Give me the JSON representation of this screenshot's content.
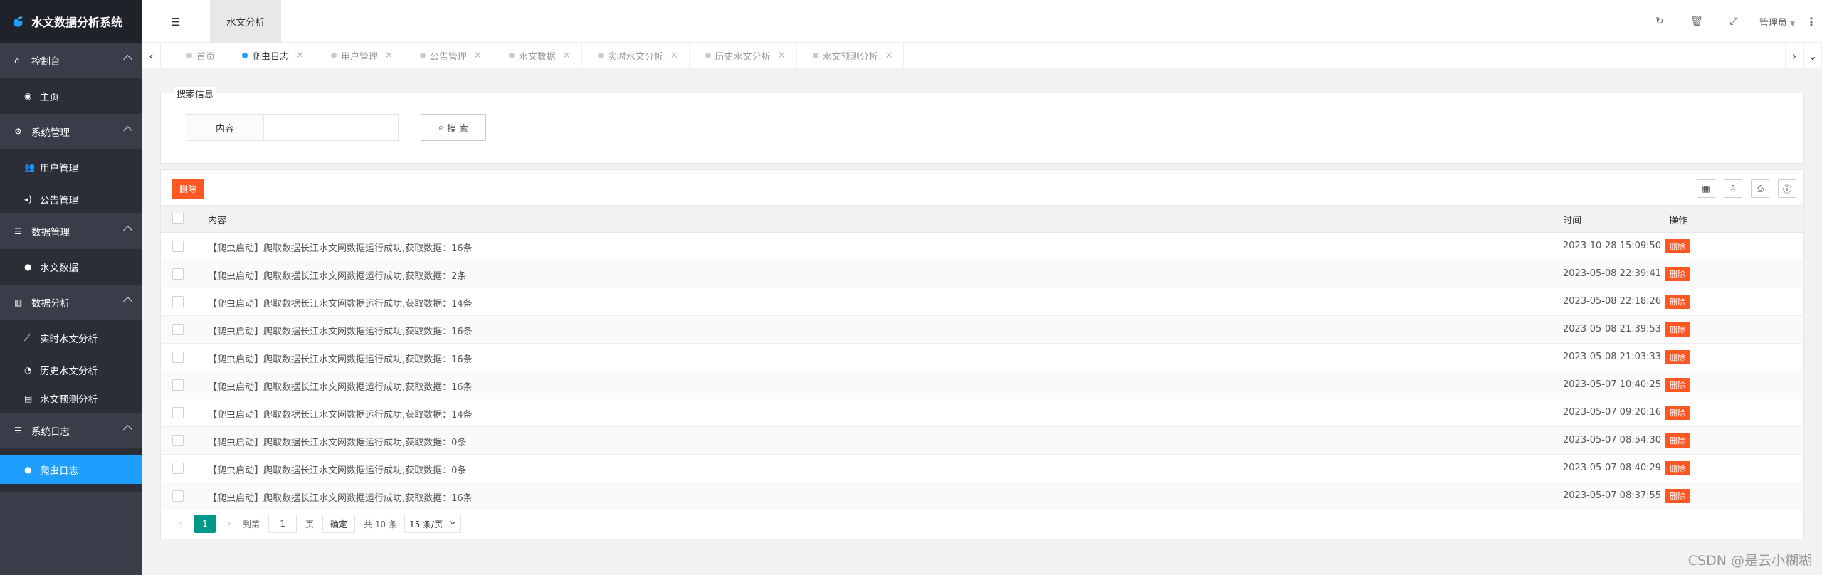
{
  "app": {
    "title": "水文数据分析系统"
  },
  "sidebar": {
    "groups": [
      {
        "label": "控制台",
        "icon": "home-icon",
        "items": [
          {
            "label": "主页",
            "icon": "dashboard-icon"
          }
        ]
      },
      {
        "label": "系统管理",
        "icon": "gears-icon",
        "items": [
          {
            "label": "用户管理",
            "icon": "users-icon"
          },
          {
            "label": "公告管理",
            "icon": "volume-icon"
          }
        ]
      },
      {
        "label": "数据管理",
        "icon": "list-icon",
        "items": [
          {
            "label": "水文数据",
            "icon": "globe-icon"
          }
        ]
      },
      {
        "label": "数据分析",
        "icon": "bar-chart-icon",
        "items": [
          {
            "label": "实时水文分析",
            "icon": "line-chart-icon"
          },
          {
            "label": "历史水文分析",
            "icon": "pie-chart-icon"
          },
          {
            "label": "水文预测分析",
            "icon": "database-icon"
          }
        ]
      },
      {
        "label": "系统日志",
        "icon": "list-icon",
        "items": [
          {
            "label": "爬虫日志",
            "icon": "globe-icon",
            "active": true
          }
        ]
      }
    ]
  },
  "header": {
    "top_tab": "水文分析",
    "user": "管理员",
    "icons": [
      "refresh-icon",
      "trash-icon",
      "fullscreen-icon"
    ]
  },
  "pagetabs": [
    {
      "label": "首页",
      "active": false
    },
    {
      "label": "爬虫日志",
      "active": true
    },
    {
      "label": "用户管理",
      "active": false
    },
    {
      "label": "公告管理",
      "active": false
    },
    {
      "label": "水文数据",
      "active": false
    },
    {
      "label": "实时水文分析",
      "active": false
    },
    {
      "label": "历史水文分析",
      "active": false
    },
    {
      "label": "水文预测分析",
      "active": false
    }
  ],
  "search": {
    "legend": "搜索信息",
    "label": "内容",
    "value": "",
    "button": "搜 索"
  },
  "table": {
    "delete_button": "删除",
    "columns": {
      "content": "内容",
      "time": "时间",
      "op": "操作"
    },
    "row_delete": "删除",
    "rows": [
      {
        "content": "【爬虫启动】爬取数据长江水文网数据运行成功,获取数据：16条",
        "time": "2023-10-28 15:09:50"
      },
      {
        "content": "【爬虫启动】爬取数据长江水文网数据运行成功,获取数据：2条",
        "time": "2023-05-08 22:39:41"
      },
      {
        "content": "【爬虫启动】爬取数据长江水文网数据运行成功,获取数据：14条",
        "time": "2023-05-08 22:18:26"
      },
      {
        "content": "【爬虫启动】爬取数据长江水文网数据运行成功,获取数据：16条",
        "time": "2023-05-08 21:39:53"
      },
      {
        "content": "【爬虫启动】爬取数据长江水文网数据运行成功,获取数据：16条",
        "time": "2023-05-08 21:03:33"
      },
      {
        "content": "【爬虫启动】爬取数据长江水文网数据运行成功,获取数据：16条",
        "time": "2023-05-07 10:40:25"
      },
      {
        "content": "【爬虫启动】爬取数据长江水文网数据运行成功,获取数据：14条",
        "time": "2023-05-07 09:20:16"
      },
      {
        "content": "【爬虫启动】爬取数据长江水文网数据运行成功,获取数据：0条",
        "time": "2023-05-07 08:54:30"
      },
      {
        "content": "【爬虫启动】爬取数据长江水文网数据运行成功,获取数据：0条",
        "time": "2023-05-07 08:40:29"
      },
      {
        "content": "【爬虫启动】爬取数据长江水文网数据运行成功,获取数据：16条",
        "time": "2023-05-07 08:37:55"
      }
    ]
  },
  "pager": {
    "current": "1",
    "goto_label": "到第",
    "goto_value": "1",
    "page_unit": "页",
    "confirm": "确定",
    "total": "共 10 条",
    "page_size": "15 条/页"
  },
  "watermark": "CSDN @是云小糊糊",
  "colors": {
    "sidebar": "#393d49",
    "active": "#1e9fff",
    "danger": "#ff5722",
    "pager": "#009688"
  }
}
